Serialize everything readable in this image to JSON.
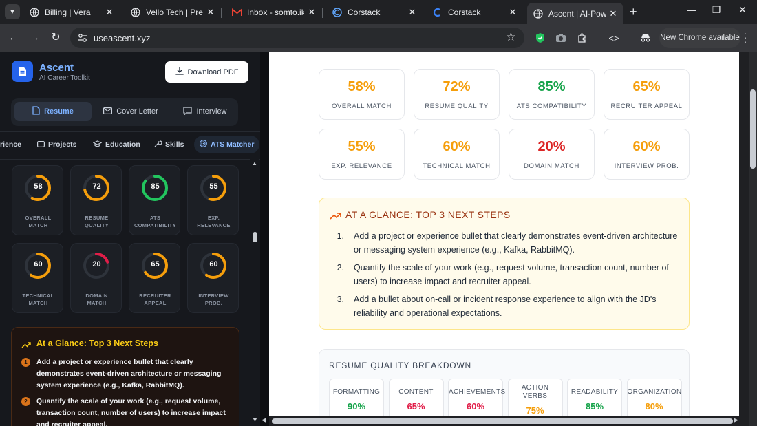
{
  "browser": {
    "tabs": [
      {
        "title": "Billing | Vera",
        "icon": "globe-icon"
      },
      {
        "title": "Vello Tech | Premium",
        "icon": "globe-icon"
      },
      {
        "title": "Inbox - somto.ike.d",
        "icon": "gmail-icon"
      },
      {
        "title": "Corstack",
        "icon": "corstack-icon"
      },
      {
        "title": "Corstack",
        "icon": "corstack-icon"
      },
      {
        "title": "Ascent | AI-Powered",
        "icon": "globe-icon"
      }
    ],
    "url": "useascent.xyz",
    "new_chrome": "New Chrome available"
  },
  "sidebar": {
    "brand_name": "Ascent",
    "brand_sub": "AI Career Toolkit",
    "download_label": "Download PDF",
    "segments": [
      {
        "label": "Resume",
        "active": true
      },
      {
        "label": "Cover Letter",
        "active": false
      },
      {
        "label": "Interview",
        "active": false
      }
    ],
    "subtabs": [
      {
        "label": "rience"
      },
      {
        "label": "Projects"
      },
      {
        "label": "Education"
      },
      {
        "label": "Skills"
      },
      {
        "label": "ATS Matcher",
        "active": true
      }
    ],
    "gauges": [
      {
        "value": 58,
        "label_1": "OVERALL",
        "label_2": "MATCH",
        "color": "#f59e0b"
      },
      {
        "value": 72,
        "label_1": "RESUME",
        "label_2": "QUALITY",
        "color": "#f59e0b"
      },
      {
        "value": 85,
        "label_1": "ATS",
        "label_2": "COMPATIBILITY",
        "color": "#22c55e"
      },
      {
        "value": 55,
        "label_1": "EXP.",
        "label_2": "RELEVANCE",
        "color": "#f59e0b"
      },
      {
        "value": 60,
        "label_1": "TECHNICAL",
        "label_2": "MATCH",
        "color": "#f59e0b"
      },
      {
        "value": 20,
        "label_1": "DOMAIN",
        "label_2": "MATCH",
        "color": "#e11d48"
      },
      {
        "value": 65,
        "label_1": "RECRUITER",
        "label_2": "APPEAL",
        "color": "#f59e0b"
      },
      {
        "value": 60,
        "label_1": "INTERVIEW",
        "label_2": "PROB.",
        "color": "#f59e0b"
      }
    ],
    "steps_title": "At a Glance: Top 3 Next Steps",
    "steps": [
      {
        "num": "1",
        "text": "Add a project or experience bullet that clearly demonstrates event-driven architecture or messaging system experience (e.g., Kafka, RabbitMQ)."
      },
      {
        "num": "2",
        "text": "Quantify the scale of your work (e.g., request volume, transaction count, number of users) to increase impact and recruiter appeal."
      }
    ]
  },
  "main": {
    "metrics": [
      {
        "value": "58%",
        "label": "OVERALL MATCH",
        "color": "#f59e0b"
      },
      {
        "value": "72%",
        "label": "RESUME QUALITY",
        "color": "#f59e0b"
      },
      {
        "value": "85%",
        "label": "ATS COMPATIBILITY",
        "color": "#16a34a"
      },
      {
        "value": "65%",
        "label": "RECRUITER APPEAL",
        "color": "#f59e0b"
      },
      {
        "value": "55%",
        "label": "EXP. RELEVANCE",
        "color": "#f59e0b"
      },
      {
        "value": "60%",
        "label": "TECHNICAL MATCH",
        "color": "#f59e0b"
      },
      {
        "value": "20%",
        "label": "DOMAIN MATCH",
        "color": "#dc2626"
      },
      {
        "value": "60%",
        "label": "INTERVIEW PROB.",
        "color": "#f59e0b"
      }
    ],
    "glance_title": "AT A GLANCE: TOP 3 NEXT STEPS",
    "glance_steps": [
      {
        "num": "1.",
        "line1": "Add a project or experience bullet that clearly demonstrates event-driven architecture",
        "line2": "or messaging system experience (e.g., Kafka, RabbitMQ)."
      },
      {
        "num": "2.",
        "line1": "Quantify the scale of your work (e.g., request volume, transaction count, number of",
        "line2": "users) to increase impact and recruiter appeal."
      },
      {
        "num": "3.",
        "line1": "Add a bullet about on-call or incident response experience to align with the JD's",
        "line2": "reliability and operational expectations."
      }
    ],
    "rq_title": "RESUME QUALITY BREAKDOWN",
    "rq_items": [
      {
        "label": "FORMATTING",
        "value": "90%",
        "color": "#16a34a"
      },
      {
        "label": "CONTENT",
        "value": "65%",
        "color": "#e11d48"
      },
      {
        "label": "ACHIEVEMENTS",
        "value": "60%",
        "color": "#e11d48"
      },
      {
        "label": "ACTION VERBS",
        "value": "75%",
        "color": "#f59e0b"
      },
      {
        "label": "READABILITY",
        "value": "85%",
        "color": "#16a34a"
      },
      {
        "label": "ORGANIZATION",
        "value": "80%",
        "color": "#f59e0b"
      }
    ]
  }
}
